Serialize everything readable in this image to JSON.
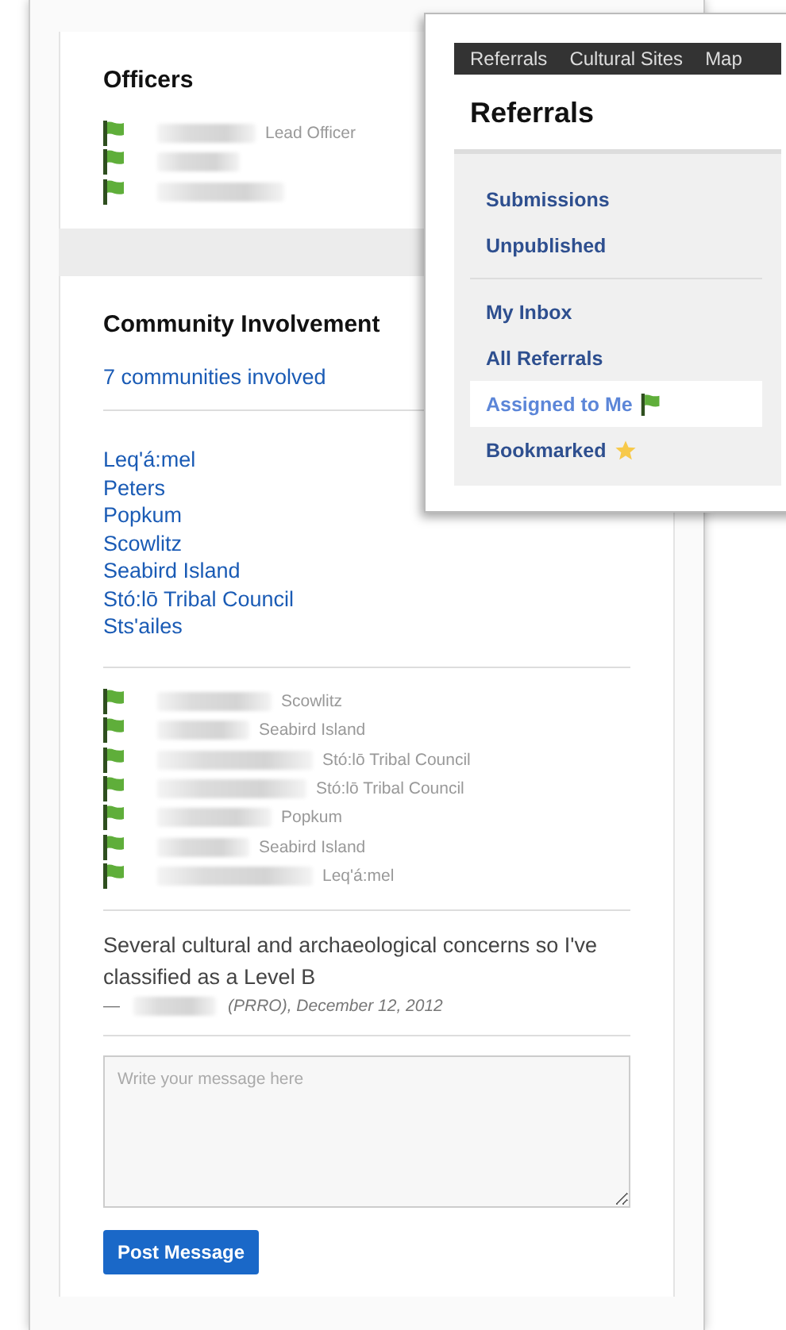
{
  "officers": {
    "title": "Officers",
    "rows": [
      {
        "flagged": true,
        "role": "Lead Officer"
      },
      {
        "flagged": true
      },
      {
        "flagged": true
      }
    ]
  },
  "community": {
    "title": "Community Involvement",
    "summary_link": "7 communities involved",
    "communities": [
      "Leq'á:mel",
      "Peters",
      "Popkum",
      "Scowlitz",
      "Seabird Island",
      "Stó:lō Tribal Council",
      "Sts'ailes"
    ],
    "contacts": [
      {
        "flagged": true,
        "community": "Scowlitz"
      },
      {
        "flagged": true,
        "community": "Seabird Island"
      },
      {
        "flagged": true,
        "community": "Stó:lō Tribal Council"
      },
      {
        "flagged": true,
        "community": "Stó:lō Tribal Council"
      },
      {
        "flagged": true,
        "community": "Popkum"
      },
      {
        "flagged": true,
        "community": "Seabird Island"
      },
      {
        "flagged": true,
        "community": "Leq'á:mel"
      }
    ],
    "comment": {
      "text": "Several cultural and archaeological concerns so I've classified as a Level B",
      "byline": "— ",
      "meta": "(PRRO), December 12, 2012"
    },
    "message": {
      "placeholder": "Write your message here"
    },
    "post_button": "Post Message"
  },
  "popup": {
    "nav": [
      "Referrals",
      "Cultural Sites",
      "Map"
    ],
    "title": "Referrals",
    "groups": [
      [
        {
          "label": "Submissions",
          "selected": false
        },
        {
          "label": "Unpublished",
          "selected": false
        }
      ],
      [
        {
          "label": "My Inbox",
          "selected": false
        },
        {
          "label": "All Referrals",
          "selected": false
        },
        {
          "label": "Assigned to Me",
          "selected": true,
          "kind": "flag"
        },
        {
          "label": "Bookmarked",
          "selected": false,
          "kind": "star"
        }
      ]
    ]
  }
}
